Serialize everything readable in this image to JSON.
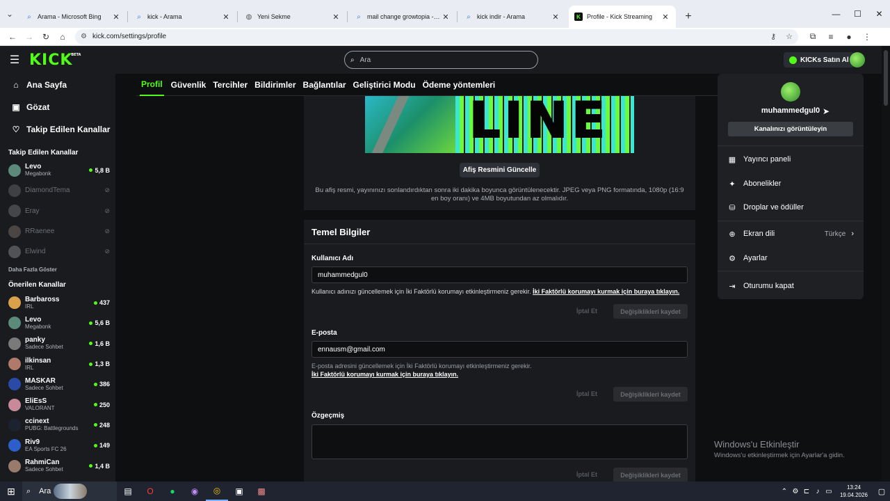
{
  "browser": {
    "tabs": [
      {
        "label": "Arama - Microsoft Bing",
        "icon": "search-icon"
      },
      {
        "label": "kick - Arama",
        "icon": "search-icon"
      },
      {
        "label": "Yeni Sekme",
        "icon": "globe-icon"
      },
      {
        "label": "mail change growtopia - Arama",
        "icon": "search-icon"
      },
      {
        "label": "kick indir - Arama",
        "icon": "search-icon"
      },
      {
        "label": "Profile - Kick Streaming",
        "icon": "kick-icon",
        "active": true
      }
    ],
    "url": "kick.com/settings/profile"
  },
  "header": {
    "logo": "KICK",
    "logo_badge": "BETA",
    "search_placeholder": "Ara",
    "buy_kicks": "KICKs Satın Al"
  },
  "sidebar": {
    "nav": [
      {
        "label": "Ana Sayfa",
        "icon": "home-icon"
      },
      {
        "label": "Gözat",
        "icon": "browse-icon"
      },
      {
        "label": "Takip Edilen Kanallar",
        "icon": "heart-icon"
      }
    ],
    "followed_heading": "Takip Edilen Kanallar",
    "followed": [
      {
        "name": "Levo",
        "category": "Megabonk",
        "viewers": "5,8 B",
        "live": true
      },
      {
        "name": "DiamondTema",
        "live": false
      },
      {
        "name": "Eray",
        "live": false
      },
      {
        "name": "RRaenee",
        "live": false
      },
      {
        "name": "Elwind",
        "live": false
      }
    ],
    "show_more": "Daha Fazla Göster",
    "recommended_heading": "Önerilen Kanallar",
    "recommended": [
      {
        "name": "Barbaross",
        "category": "IRL",
        "viewers": "437"
      },
      {
        "name": "Levo",
        "category": "Megabonk",
        "viewers": "5,6 B"
      },
      {
        "name": "panky",
        "category": "Sadece Sohbet",
        "viewers": "1,6 B"
      },
      {
        "name": "ilkinsan",
        "category": "IRL",
        "viewers": "1,3 B"
      },
      {
        "name": "MASKAR",
        "category": "Sadece Sohbet",
        "viewers": "386"
      },
      {
        "name": "EliEsS",
        "category": "VALORANT",
        "viewers": "250"
      },
      {
        "name": "ccinext",
        "category": "PUBG: Battlegrounds",
        "viewers": "248"
      },
      {
        "name": "Riv9",
        "category": "EA Sports FC 26",
        "viewers": "149"
      },
      {
        "name": "RahmiCan",
        "category": "Sadece Sohbet",
        "viewers": "1,4 B"
      }
    ]
  },
  "settings_tabs": [
    "Profil",
    "Güvenlik",
    "Tercihler",
    "Bildirimler",
    "Bağlantılar",
    "Geliştirici Modu",
    "Ödeme yöntemleri"
  ],
  "banner": {
    "word": "LINE",
    "update_button": "Afiş Resmini Güncelle",
    "hint": "Bu afiş resmi, yayınınızı sonlandırdıktan sonra iki dakika boyunca görüntülenecektir. JPEG veya PNG formatında, 1080p (16:9 en boy oranı) ve 4MB boyutundan az olmalıdır."
  },
  "basic_info": {
    "title": "Temel Bilgiler",
    "username_label": "Kullanıcı Adı",
    "username_value": "muhammedgul0",
    "username_hint": "Kullanıcı adınızı güncellemek için İki Faktörlü korumayı etkinleştirmeniz gerekir.",
    "username_hint_link": "İki Faktörlü korumayı kurmak için buraya tıklayın.",
    "email_label": "E-posta",
    "email_value": "ennausm@gmail.com",
    "email_hint": "E-posta adresini güncellemek için İki Faktörlü korumayı etkinleştirmeniz gerekir.",
    "email_hint_link": "İki Faktörlü korumayı kurmak için buraya tıklayın.",
    "bio_label": "Özgeçmiş",
    "cancel": "İptal Et",
    "save": "Değişiklikleri kaydet"
  },
  "dropdown": {
    "username": "muhammedgul0",
    "view_channel": "Kanalınızı görüntüleyin",
    "items": [
      {
        "label": "Yayıncı paneli",
        "icon": "dashboard-icon"
      },
      {
        "label": "Abonelikler",
        "icon": "sparkle-icon"
      },
      {
        "label": "Droplar ve ödüller",
        "icon": "drops-icon"
      },
      {
        "label": "Ekran dili",
        "icon": "globe-icon",
        "value": "Türkçe"
      },
      {
        "label": "Ayarlar",
        "icon": "gear-icon"
      },
      {
        "label": "Oturumu kapat",
        "icon": "logout-icon"
      }
    ]
  },
  "watermark": {
    "title": "Windows'u Etkinleştir",
    "subtitle": "Windows'u etkinleştirmek için Ayarlar'a gidin."
  },
  "taskbar": {
    "search": "Ara",
    "time": "13:24",
    "date": "19.04.2026"
  }
}
